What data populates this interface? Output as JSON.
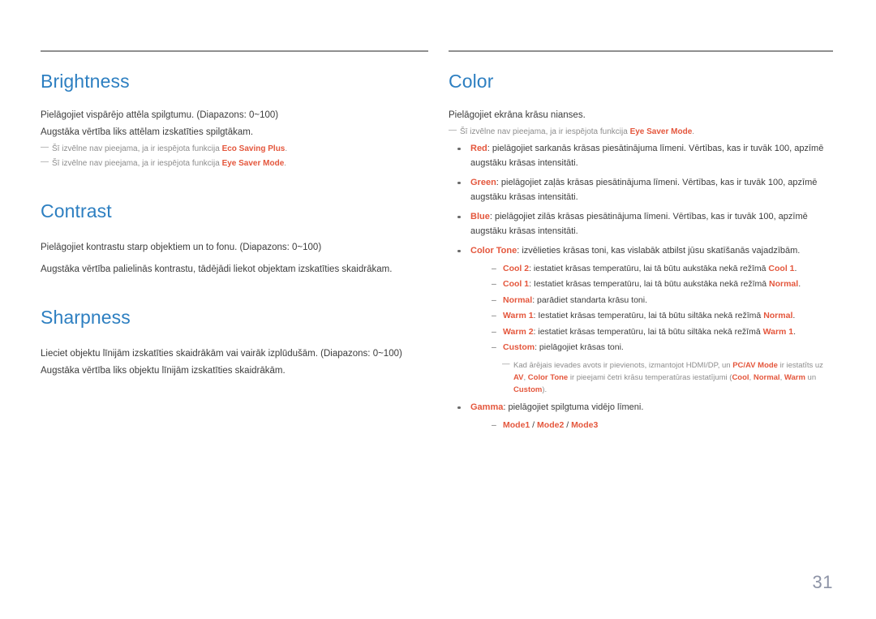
{
  "page_number": "31",
  "colors": {
    "heading": "#2d7fc1",
    "accent": "#e4573d",
    "body": "#3c3c3c",
    "note": "#8d8d8d",
    "rule": "#8f8f8f",
    "page_number": "#8d93a6"
  },
  "left_column": {
    "sections": [
      {
        "title": "Brightness",
        "body": [
          "Pielāgojiet vispārējo attēla spilgtumu. (Diapazons: 0~100)",
          "Augstāka vērtība liks attēlam izskatīties spilgtākam."
        ],
        "notes": [
          {
            "prefix": "Šī izvēlne nav pieejama, ja ir iespējota funkcija ",
            "accent": "Eco Saving Plus",
            "suffix": "."
          },
          {
            "prefix": "Šī izvēlne nav pieejama, ja ir iespējota funkcija ",
            "accent": "Eye Saver Mode",
            "suffix": "."
          }
        ]
      },
      {
        "title": "Contrast",
        "body": [
          "Pielāgojiet kontrastu starp objektiem un to fonu. (Diapazons: 0~100)",
          "Augstāka vērtība palielinās kontrastu, tādējādi liekot objektam izskatīties skaidrākam."
        ],
        "notes": []
      },
      {
        "title": "Sharpness",
        "body": [
          "Lieciet objektu līnijām izskatīties skaidrākām vai vairāk izplūdušām. (Diapazons: 0~100)",
          "Augstāka vērtība liks objektu līnijām izskatīties skaidrākām."
        ],
        "notes": []
      }
    ]
  },
  "right_column": {
    "title": "Color",
    "body": [
      "Pielāgojiet ekrāna krāsu nianses."
    ],
    "notes": [
      {
        "prefix": "Šī izvēlne nav pieejama, ja ir iespējota funkcija ",
        "accent": "Eye Saver Mode",
        "suffix": "."
      }
    ],
    "bullets": {
      "red": {
        "label": "Red",
        "text": ": pielāgojiet sarkanās krāsas piesātinājuma līmeni. Vērtības, kas ir tuvāk 100, apzīmē augstāku krāsas intensitāti."
      },
      "green": {
        "label": "Green",
        "text": ": pielāgojiet zaļās krāsas piesātinājuma līmeni. Vērtības, kas ir tuvāk 100, apzīmē augstāku krāsas intensitāti."
      },
      "blue": {
        "label": "Blue",
        "text": ": pielāgojiet zilās krāsas piesātinājuma līmeni. Vērtības, kas ir tuvāk 100, apzīmē augstāku krāsas intensitāti."
      },
      "color_tone": {
        "label": "Color Tone",
        "text": ": izvēlieties krāsas toni, kas vislabāk atbilst jūsu skatīšanās vajadzībām."
      },
      "gamma": {
        "label": "Gamma",
        "text": ": pielāgojiet spilgtuma vidējo līmeni."
      }
    },
    "color_tone_subitems": [
      {
        "label": "Cool 2",
        "mid": ": iestatiet krāsas temperatūru, lai tā būtu aukstāka nekā režīmā ",
        "ref": "Cool 1",
        "end": "."
      },
      {
        "label": "Cool 1",
        "mid": ": Iestatiet krāsas temperatūru, lai tā būtu aukstāka nekā režīmā ",
        "ref": "Normal",
        "end": "."
      },
      {
        "label": "Normal",
        "mid": ": parādiet standarta krāsu toni.",
        "ref": "",
        "end": ""
      },
      {
        "label": "Warm 1",
        "mid": ": Iestatiet krāsas temperatūru, lai tā būtu siltāka nekā režīmā ",
        "ref": "Normal",
        "end": "."
      },
      {
        "label": "Warm 2",
        "mid": ": iestatiet krāsas temperatūru, lai tā būtu siltāka nekā režīmā ",
        "ref": "Warm 1",
        "end": "."
      },
      {
        "label": "Custom",
        "mid": ": pielāgojiet krāsas toni.",
        "ref": "",
        "end": ""
      }
    ],
    "color_tone_note": {
      "p1": "Kad ārējais ievades avots ir pievienots, izmantojot HDMI/DP, un ",
      "a1": "PC/AV Mode",
      "p2": " ir iestatīts uz ",
      "a2": "AV",
      "p3": ", ",
      "a3": "Color Tone",
      "p4": " ir pieejami četri krāsu temperatūras iestatījumi (",
      "a4": "Cool",
      "p5": ", ",
      "a5": "Normal",
      "p6": ", ",
      "a6": "Warm",
      "p7": " un ",
      "a7": "Custom",
      "p8": ")."
    },
    "gamma_modes": {
      "mode1": "Mode1",
      "sep1": " / ",
      "mode2": "Mode2",
      "sep2": " / ",
      "mode3": "Mode3"
    }
  }
}
